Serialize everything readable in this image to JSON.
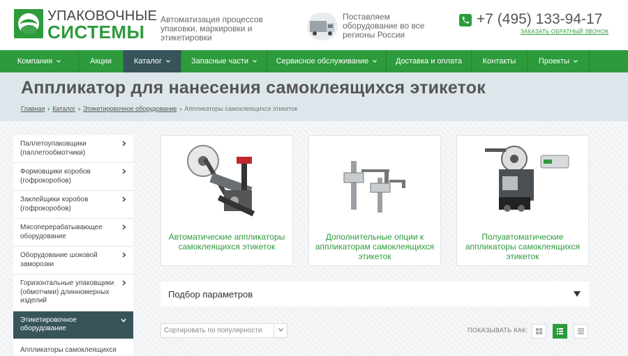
{
  "header": {
    "logo_line1": "УПАКОВОЧНЫЕ",
    "logo_line2": "СИСТЕМЫ",
    "tagline": "Автоматизация процессов упаковки, маркировки и этикетировки",
    "delivery_text": "Поставляем оборудование во все регионы России",
    "phone": "+7 (495) 133-94-17",
    "callback": "ЗАКАЗАТЬ ОБРАТНЫЙ ЗВОНОК"
  },
  "nav": {
    "items": [
      {
        "label": "Компания"
      },
      {
        "label": "Акции"
      },
      {
        "label": "Каталог"
      },
      {
        "label": "Запасные части"
      },
      {
        "label": "Сервисное обслуживание"
      },
      {
        "label": "Доставка и оплата"
      },
      {
        "label": "Контакты"
      },
      {
        "label": "Проекты"
      }
    ]
  },
  "page": {
    "title": "Аппликатор для нанесения самоклеящихся этикеток",
    "breadcrumb": [
      "Главная",
      "Каталог",
      "Этикетировочное оборудование",
      "Аппликаторы самоклеящихся этикеток"
    ]
  },
  "sidebar": {
    "items": [
      {
        "label": "Паллетоупаковщики (паллетообмотчики)"
      },
      {
        "label": "Формовщики коробов (гофрокоробов)"
      },
      {
        "label": "Заклейщики коробов (гофрокоробов)"
      },
      {
        "label": "Мясоперерабатывающее оборудование"
      },
      {
        "label": "Оборудование шоковой заморозки"
      },
      {
        "label": "Горизонтальные упаковщики (обмотчики) длинномерных изделий"
      },
      {
        "label": "Этикетировочное оборудование"
      },
      {
        "label": "Аппликаторы самоклеящихся"
      }
    ]
  },
  "cards": [
    {
      "caption": "Автоматические аппликаторы самоклеящихся этикеток"
    },
    {
      "caption": "Дополнительные опции к аппликаторам самоклеящихся этикеток"
    },
    {
      "caption": "Полуавтоматические аппликаторы самоклеящихся этикеток"
    }
  ],
  "filter": {
    "label": "Подбор параметров"
  },
  "sort": {
    "value": "Сортировать по популярности"
  },
  "view": {
    "label": "ПОКАЗЫВАТЬ КАК:"
  },
  "colors": {
    "brand_green": "#2d9b3c",
    "nav_active": "#37545b",
    "title_bg": "#dde6ea"
  }
}
